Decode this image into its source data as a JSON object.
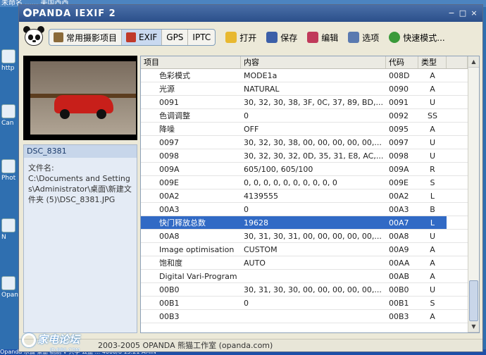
{
  "desktop": {
    "top_text": "未命名 ...... 美国西西",
    "icons": [
      {
        "label": "http"
      },
      {
        "label": "Can"
      },
      {
        "label": "Phot"
      },
      {
        "label": "N"
      },
      {
        "label": "Opan"
      }
    ],
    "taskbar_text": "Opanda     水摄     条册     测测 V 共享     公益     ...     4000/8     13:21 AMIN"
  },
  "window": {
    "title": "PANDA IEXIF 2",
    "controls": {
      "minimize": "−",
      "maximize": "□",
      "close": "×"
    }
  },
  "toolbar": {
    "tabs": [
      {
        "label": "常用摄影项目",
        "active": false
      },
      {
        "label": "EXIF",
        "active": true
      },
      {
        "label": "GPS",
        "active": false
      },
      {
        "label": "IPTC",
        "active": false
      }
    ],
    "buttons": [
      {
        "label": "打开"
      },
      {
        "label": "保存"
      },
      {
        "label": "编辑"
      },
      {
        "label": "选项"
      },
      {
        "label": "快速模式..."
      }
    ]
  },
  "file": {
    "name": "DSC_8381",
    "path_label": "文件名:",
    "path": "C:\\Documents and Settings\\Administrator\\桌面\\新建文件夹 (5)\\DSC_8381.JPG"
  },
  "table": {
    "headers": [
      "项目",
      "内容",
      "代码",
      "类型"
    ],
    "rows": [
      [
        "色彩模式",
        "MODE1a",
        "008D",
        "A"
      ],
      [
        "光源",
        "NATURAL",
        "0090",
        "A"
      ],
      [
        "0091",
        "30, 32, 30, 38, 3F, 0C, 37, 89, BD,...",
        "0091",
        "U"
      ],
      [
        "色调调整",
        "0",
        "0092",
        "SS"
      ],
      [
        "降噪",
        "OFF",
        "0095",
        "A"
      ],
      [
        "0097",
        "30, 32, 30, 38, 00, 00, 00, 00, 00,...",
        "0097",
        "U"
      ],
      [
        "0098",
        "30, 32, 30, 32, 0D, 35, 31, E8, AC,...",
        "0098",
        "U"
      ],
      [
        "009A",
        "605/100, 605/100",
        "009A",
        "R"
      ],
      [
        "009E",
        "0, 0, 0, 0, 0, 0, 0, 0, 0, 0",
        "009E",
        "S"
      ],
      [
        "00A2",
        "4139555",
        "00A2",
        "L"
      ],
      [
        "00A3",
        "0",
        "00A3",
        "B"
      ],
      [
        "快门释放总数",
        "19628",
        "00A7",
        "L"
      ],
      [
        "00A8",
        "30, 31, 30, 31, 00, 00, 00, 00, 00,...",
        "00A8",
        "U"
      ],
      [
        "Image optimisation",
        "CUSTOM",
        "00A9",
        "A"
      ],
      [
        "饱和度",
        "AUTO",
        "00AA",
        "A"
      ],
      [
        "Digital Vari-Program",
        "",
        "00AB",
        "A"
      ],
      [
        "00B0",
        "30, 31, 30, 30, 00, 00, 00, 00, 00,...",
        "00B0",
        "U"
      ],
      [
        "00B1",
        "0",
        "00B1",
        "S"
      ],
      [
        "00B3",
        "",
        "00B3",
        "A"
      ]
    ],
    "selected_row": 11
  },
  "status": {
    "text": "2003-2005 OPANDA 熊猫工作室 (opanda.com)"
  },
  "watermark": {
    "line1": "家电论坛",
    "line2": "JD-BBS.COM"
  }
}
